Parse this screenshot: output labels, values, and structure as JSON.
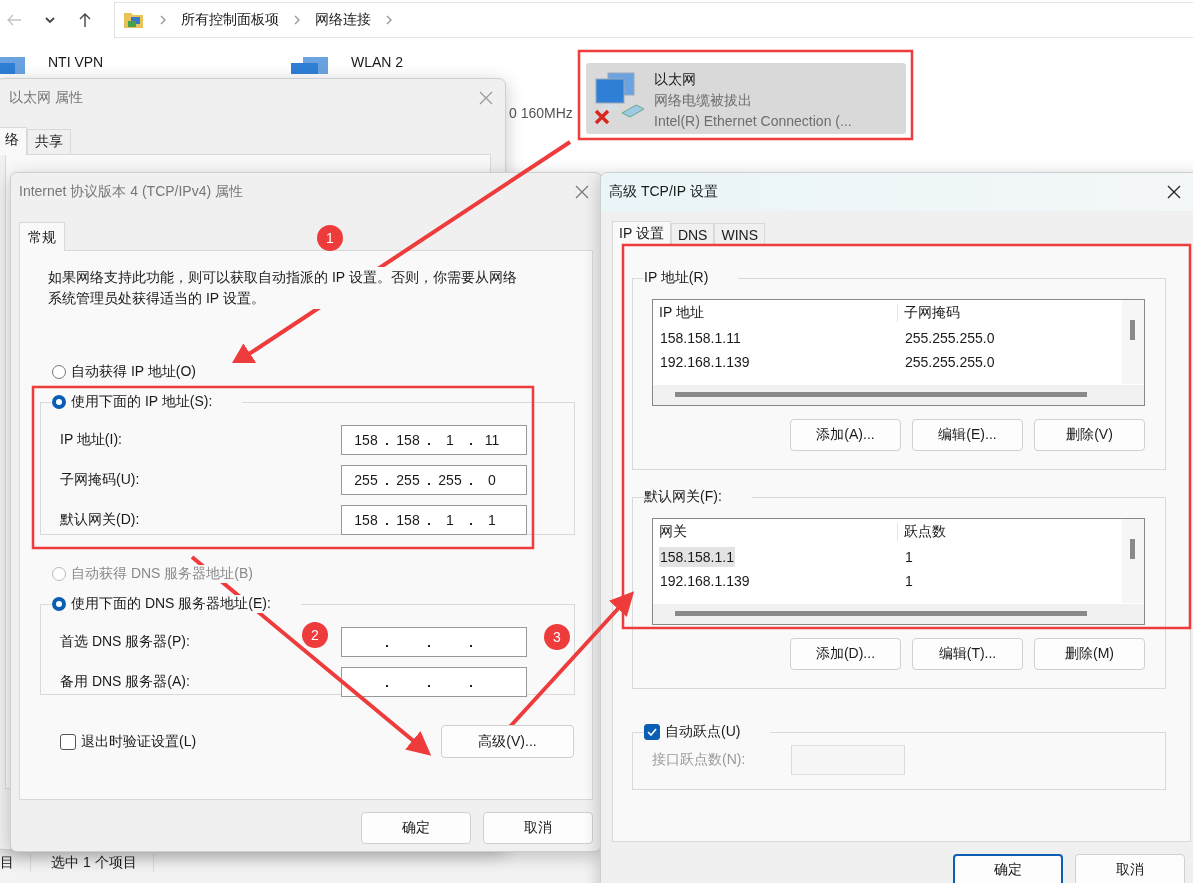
{
  "explorer": {
    "breadcrumbs": [
      "所有控制面板项",
      "网络连接"
    ],
    "connections": [
      {
        "name": "NTI VPN",
        "selected": false
      },
      {
        "name": "WLAN 2",
        "detail": "0 160MHz",
        "selected": false
      },
      {
        "name": "以太网",
        "status": "网络电缆被拔出",
        "detail": "Intel(R) Ethernet Connection (...",
        "selected": true,
        "disconnected": true
      }
    ],
    "status_bar": [
      "目",
      "选中 1 个项目"
    ]
  },
  "ethernet_properties": {
    "title": "以太网 属性",
    "tabs": [
      {
        "label": "络",
        "selected": true
      },
      {
        "label": "共享",
        "selected": false
      }
    ]
  },
  "ipv4_dialog": {
    "title": "Internet 协议版本 4 (TCP/IPv4) 属性",
    "tabs": [
      {
        "label": "常规",
        "selected": true
      }
    ],
    "description": "如果网络支持此功能，则可以获取自动指派的 IP 设置。否则，你需要从网络系统管理员处获得适当的 IP 设置。",
    "ip": {
      "auto": {
        "label": "自动获得 IP 地址(O)",
        "selected": false,
        "disabled": false
      },
      "manual": {
        "label": "使用下面的 IP 地址(S):",
        "selected": true
      },
      "fields": [
        {
          "label": "IP 地址(I):",
          "octets": [
            "158",
            "158",
            "1",
            "11"
          ]
        },
        {
          "label": "子网掩码(U):",
          "octets": [
            "255",
            "255",
            "255",
            "0"
          ]
        },
        {
          "label": "默认网关(D):",
          "octets": [
            "158",
            "158",
            "1",
            "1"
          ]
        }
      ]
    },
    "dns": {
      "auto": {
        "label": "自动获得 DNS 服务器地址(B)",
        "selected": false,
        "disabled": true
      },
      "manual": {
        "label": "使用下面的 DNS 服务器地址(E):",
        "selected": true
      },
      "fields": [
        {
          "label": "首选 DNS 服务器(P):"
        },
        {
          "label": "备用 DNS 服务器(A):"
        }
      ]
    },
    "validate": {
      "label": "退出时验证设置(L)",
      "checked": false
    },
    "advanced_button": "高级(V)...",
    "buttons": [
      "确定",
      "取消"
    ]
  },
  "advanced_dialog": {
    "title": "高级 TCP/IP 设置",
    "tabs": [
      {
        "label": "IP 设置",
        "selected": true
      },
      {
        "label": "DNS",
        "selected": false
      },
      {
        "label": "WINS",
        "selected": false
      }
    ],
    "groups": [
      {
        "title": "IP 地址(R)",
        "columns": [
          "IP 地址",
          "子网掩码"
        ],
        "rows": [
          {
            "cells": [
              "158.158.1.11",
              "255.255.255.0"
            ],
            "selected": false
          },
          {
            "cells": [
              "192.168.1.139",
              "255.255.255.0"
            ],
            "selected": false
          }
        ],
        "buttons": [
          "添加(A)...",
          "编辑(E)...",
          "删除(V)"
        ]
      },
      {
        "title": "默认网关(F):",
        "columns": [
          "网关",
          "跃点数"
        ],
        "rows": [
          {
            "cells": [
              "158.158.1.1",
              "1"
            ],
            "selected": true
          },
          {
            "cells": [
              "192.168.1.139",
              "1"
            ],
            "selected": false
          }
        ],
        "buttons": [
          "添加(D)...",
          "编辑(T)...",
          "删除(M)"
        ]
      }
    ],
    "auto_metric": {
      "label": "自动跃点(U)",
      "checked": true
    },
    "interface_metric": {
      "label": "接口跃点数(N):",
      "disabled": true
    },
    "buttons": [
      {
        "label": "确定",
        "default": true
      },
      {
        "label": "取消",
        "default": false
      }
    ]
  },
  "annotations": {
    "steps": [
      {
        "label": "1"
      },
      {
        "label": "2"
      },
      {
        "label": "3"
      }
    ]
  }
}
